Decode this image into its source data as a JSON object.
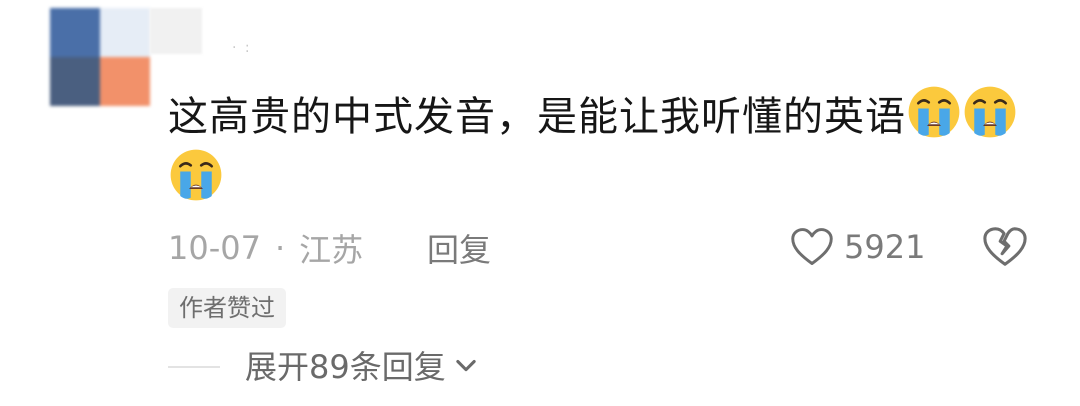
{
  "comment": {
    "text": "这高贵的中式发音，是能让我听懂的英语",
    "emoji_icon": "loudly-crying-face-icon",
    "date": "10-07",
    "separator": "·",
    "location": "江苏",
    "reply_label": "回复",
    "like_count": "5921",
    "author_badge": "作者赞过",
    "expand_label": "展开89条回复"
  }
}
